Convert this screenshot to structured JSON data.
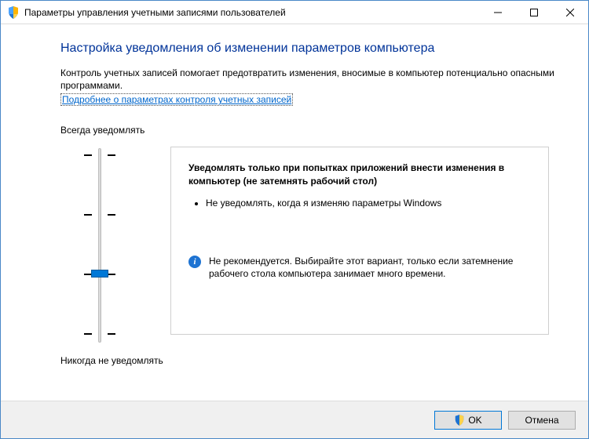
{
  "window": {
    "title": "Параметры управления учетными записями пользователей"
  },
  "heading": "Настройка уведомления об изменении параметров компьютера",
  "description": "Контроль учетных записей помогает предотвратить изменения, вносимые в компьютер потенциально опасными программами.",
  "help_link": "Подробнее о параметрах контроля учетных записей",
  "slider": {
    "top_label": "Всегда уведомлять",
    "bottom_label": "Никогда не уведомлять",
    "levels": 4,
    "current_level_index": 2
  },
  "panel": {
    "title": "Уведомлять только при попытках приложений внести изменения в компьютер (не затемнять рабочий стол)",
    "bullets": [
      "Не уведомлять, когда я изменяю параметры Windows"
    ],
    "note": "Не рекомендуется. Выбирайте этот вариант, только если затемнение рабочего стола компьютера занимает много времени."
  },
  "buttons": {
    "ok": "OK",
    "cancel": "Отмена"
  },
  "icons": {
    "shield": "shield-icon",
    "info": "info-icon",
    "minimize": "minimize-icon",
    "maximize": "maximize-icon",
    "close": "close-icon"
  }
}
